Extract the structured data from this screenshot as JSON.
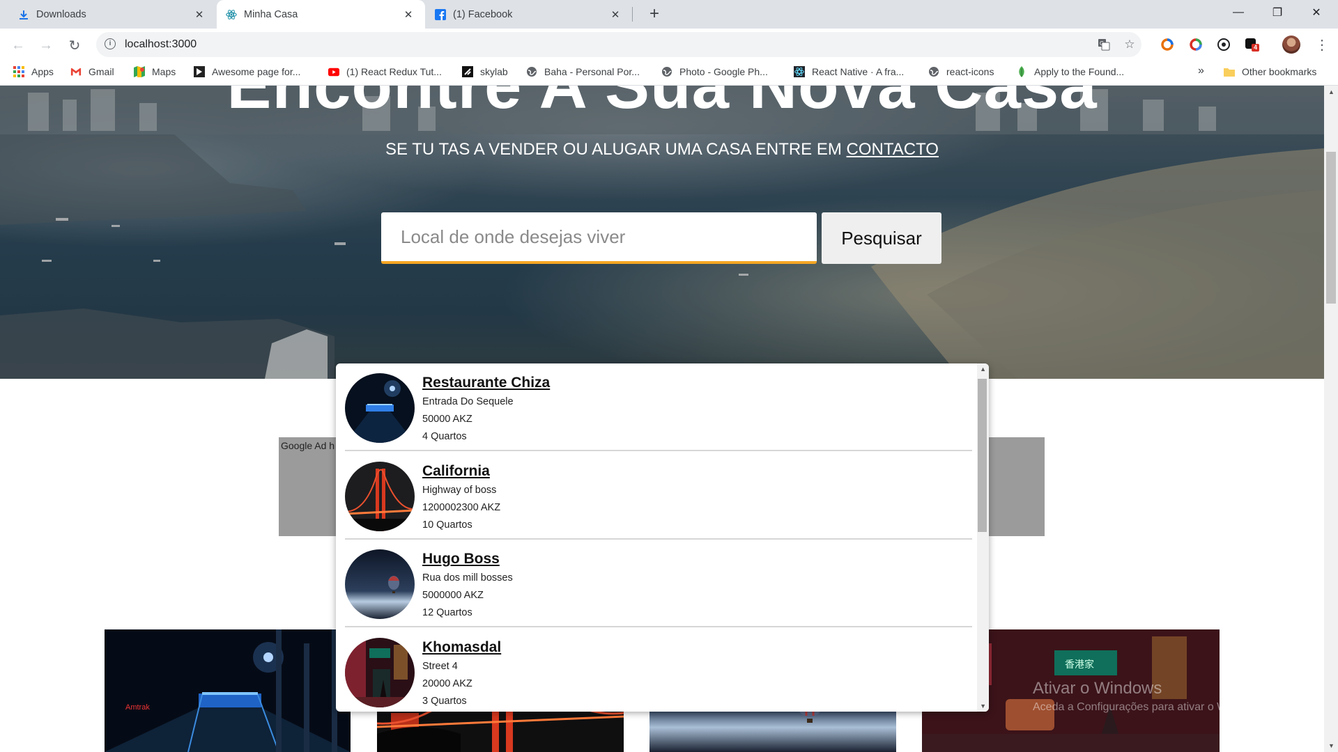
{
  "tabs": [
    {
      "title": "Downloads",
      "icon": "download-icon"
    },
    {
      "title": "Minha Casa",
      "icon": "react-icon"
    },
    {
      "title": "(1) Facebook",
      "icon": "facebook-icon"
    }
  ],
  "address": {
    "url": "localhost:3000"
  },
  "bookmarks": [
    {
      "label": "Apps",
      "icon": "apps-grid-icon"
    },
    {
      "label": "Gmail",
      "icon": "gmail-icon"
    },
    {
      "label": "Maps",
      "icon": "maps-icon"
    },
    {
      "label": "Awesome page for...",
      "icon": "arrow-icon"
    },
    {
      "label": "(1) React Redux Tut...",
      "icon": "youtube-icon"
    },
    {
      "label": "skylab",
      "icon": "skylab-icon"
    },
    {
      "label": "Baha - Personal Por...",
      "icon": "globe-icon"
    },
    {
      "label": "Photo - Google Ph...",
      "icon": "globe-icon"
    },
    {
      "label": "React Native · A fra...",
      "icon": "react-icon"
    },
    {
      "label": "react-icons",
      "icon": "globe-icon"
    },
    {
      "label": "Apply to the Found...",
      "icon": "leaf-icon"
    }
  ],
  "bookmarks_overflow": "»",
  "other_bookmarks": "Other bookmarks",
  "extension_badge": "4",
  "hero": {
    "title": "Encontre A Sua Nova Casa",
    "subtitle": "SE TU TAS A VENDER OU ALUGAR UMA CASA ENTRE EM",
    "contact_link": "CONTACTO"
  },
  "search": {
    "placeholder": "Local de onde desejas viver",
    "button": "Pesquisar"
  },
  "ad": {
    "label": "Google Ad h"
  },
  "results": [
    {
      "name": "Restaurante Chiza",
      "address": "Entrada Do Sequele",
      "price": "50000 AKZ",
      "rooms": "4 Quartos"
    },
    {
      "name": "California",
      "address": "Highway of boss",
      "price": "1200002300 AKZ",
      "rooms": "10 Quartos"
    },
    {
      "name": "Hugo Boss",
      "address": "Rua dos mill bosses",
      "price": "5000000 AKZ",
      "rooms": "12 Quartos"
    },
    {
      "name": "Khomasdal",
      "address": "Street 4",
      "price": "20000 AKZ",
      "rooms": "3 Quartos"
    }
  ],
  "watermark": {
    "title": "Ativar o Windows",
    "text": "Aceda a Configurações para ativar o Windows."
  }
}
